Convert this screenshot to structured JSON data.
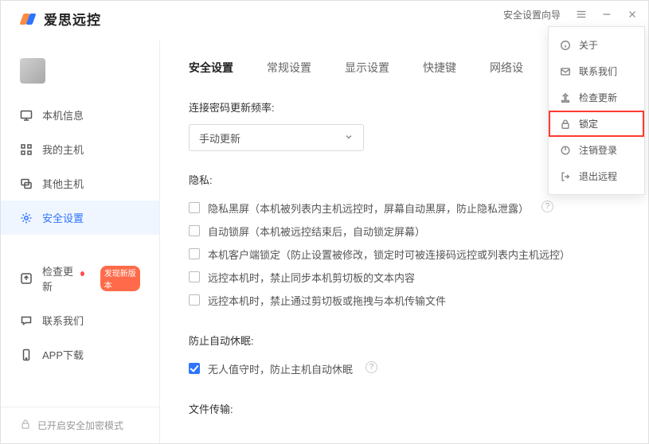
{
  "brand": {
    "name": "爱思远控"
  },
  "titlebar": {
    "wizard": "安全设置向导"
  },
  "sidebar": {
    "items": [
      {
        "icon": "monitor-icon",
        "label": "本机信息"
      },
      {
        "icon": "grid-icon",
        "label": "我的主机"
      },
      {
        "icon": "hosts-icon",
        "label": "其他主机"
      },
      {
        "icon": "gear-icon",
        "label": "安全设置",
        "active": true
      },
      {
        "icon": "update-icon",
        "label": "检查更新",
        "badge": "发现新版本"
      },
      {
        "icon": "chat-icon",
        "label": "联系我们"
      },
      {
        "icon": "phone-icon",
        "label": "APP下载"
      }
    ],
    "bottom": {
      "label": "已开启安全加密模式"
    }
  },
  "tabs": [
    {
      "label": "安全设置",
      "active": true
    },
    {
      "label": "常规设置"
    },
    {
      "label": "显示设置"
    },
    {
      "label": "快捷键"
    },
    {
      "label": "网络设"
    }
  ],
  "security": {
    "freq_label": "连接密码更新频率:",
    "freq_value": "手动更新",
    "privacy_label": "隐私:",
    "privacy_opts": [
      {
        "checked": false,
        "text": "隐私黑屏（本机被列表内主机远控时，屏幕自动黑屏，防止隐私泄露）"
      },
      {
        "checked": false,
        "text": "自动锁屏（本机被远控结束后，自动锁定屏幕）"
      },
      {
        "checked": false,
        "text": "本机客户端锁定（防止设置被修改，锁定时可被连接码远控或列表内主机远控）"
      },
      {
        "checked": false,
        "text": "远控本机时，禁止同步本机剪切板的文本内容"
      },
      {
        "checked": false,
        "text": "远控本机时，禁止通过剪切板或拖拽与本机传输文件"
      }
    ],
    "sleep_label": "防止自动休眠:",
    "sleep_opt": {
      "checked": true,
      "text": "无人值守时，防止主机自动休眠"
    },
    "file_label": "文件传输:"
  },
  "menu": {
    "items": [
      {
        "icon": "info-icon",
        "label": "关于"
      },
      {
        "icon": "mail-icon",
        "label": "联系我们"
      },
      {
        "icon": "update-icon",
        "label": "检查更新"
      },
      {
        "icon": "lock-icon",
        "label": "锁定",
        "highlight": true
      },
      {
        "icon": "power-icon",
        "label": "注销登录"
      },
      {
        "icon": "exit-icon",
        "label": "退出远程"
      }
    ]
  }
}
